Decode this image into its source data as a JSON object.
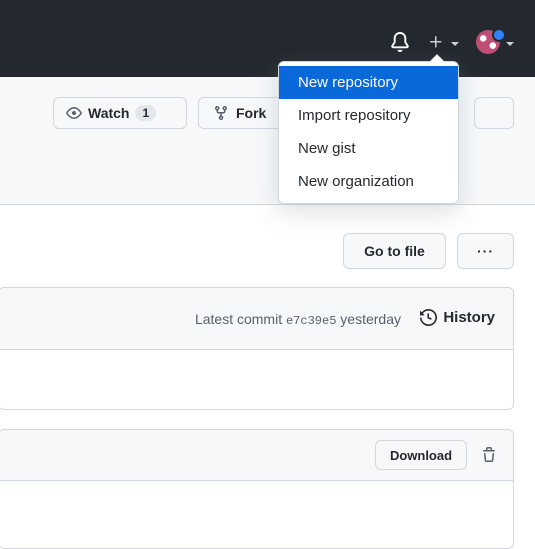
{
  "header": {
    "icons": [
      "bell-icon",
      "plus-icon",
      "avatar"
    ]
  },
  "repo_actions": {
    "watch_label": "Watch",
    "watch_count": "1",
    "fork_label": "Fork"
  },
  "create_menu": {
    "items": [
      "New repository",
      "Import repository",
      "New gist",
      "New organization"
    ],
    "active_index": 0
  },
  "file_nav": {
    "go_to_file": "Go to file",
    "more": "···"
  },
  "commit_bar": {
    "latest_prefix": "Latest commit",
    "sha": "e7c39e5",
    "when": "yesterday",
    "history_label": "History"
  },
  "file_header": {
    "download_label": "Download"
  },
  "colors": {
    "header_bg": "#24292f",
    "accent": "#0969da",
    "border": "#d0d7de",
    "muted": "#57606a"
  }
}
